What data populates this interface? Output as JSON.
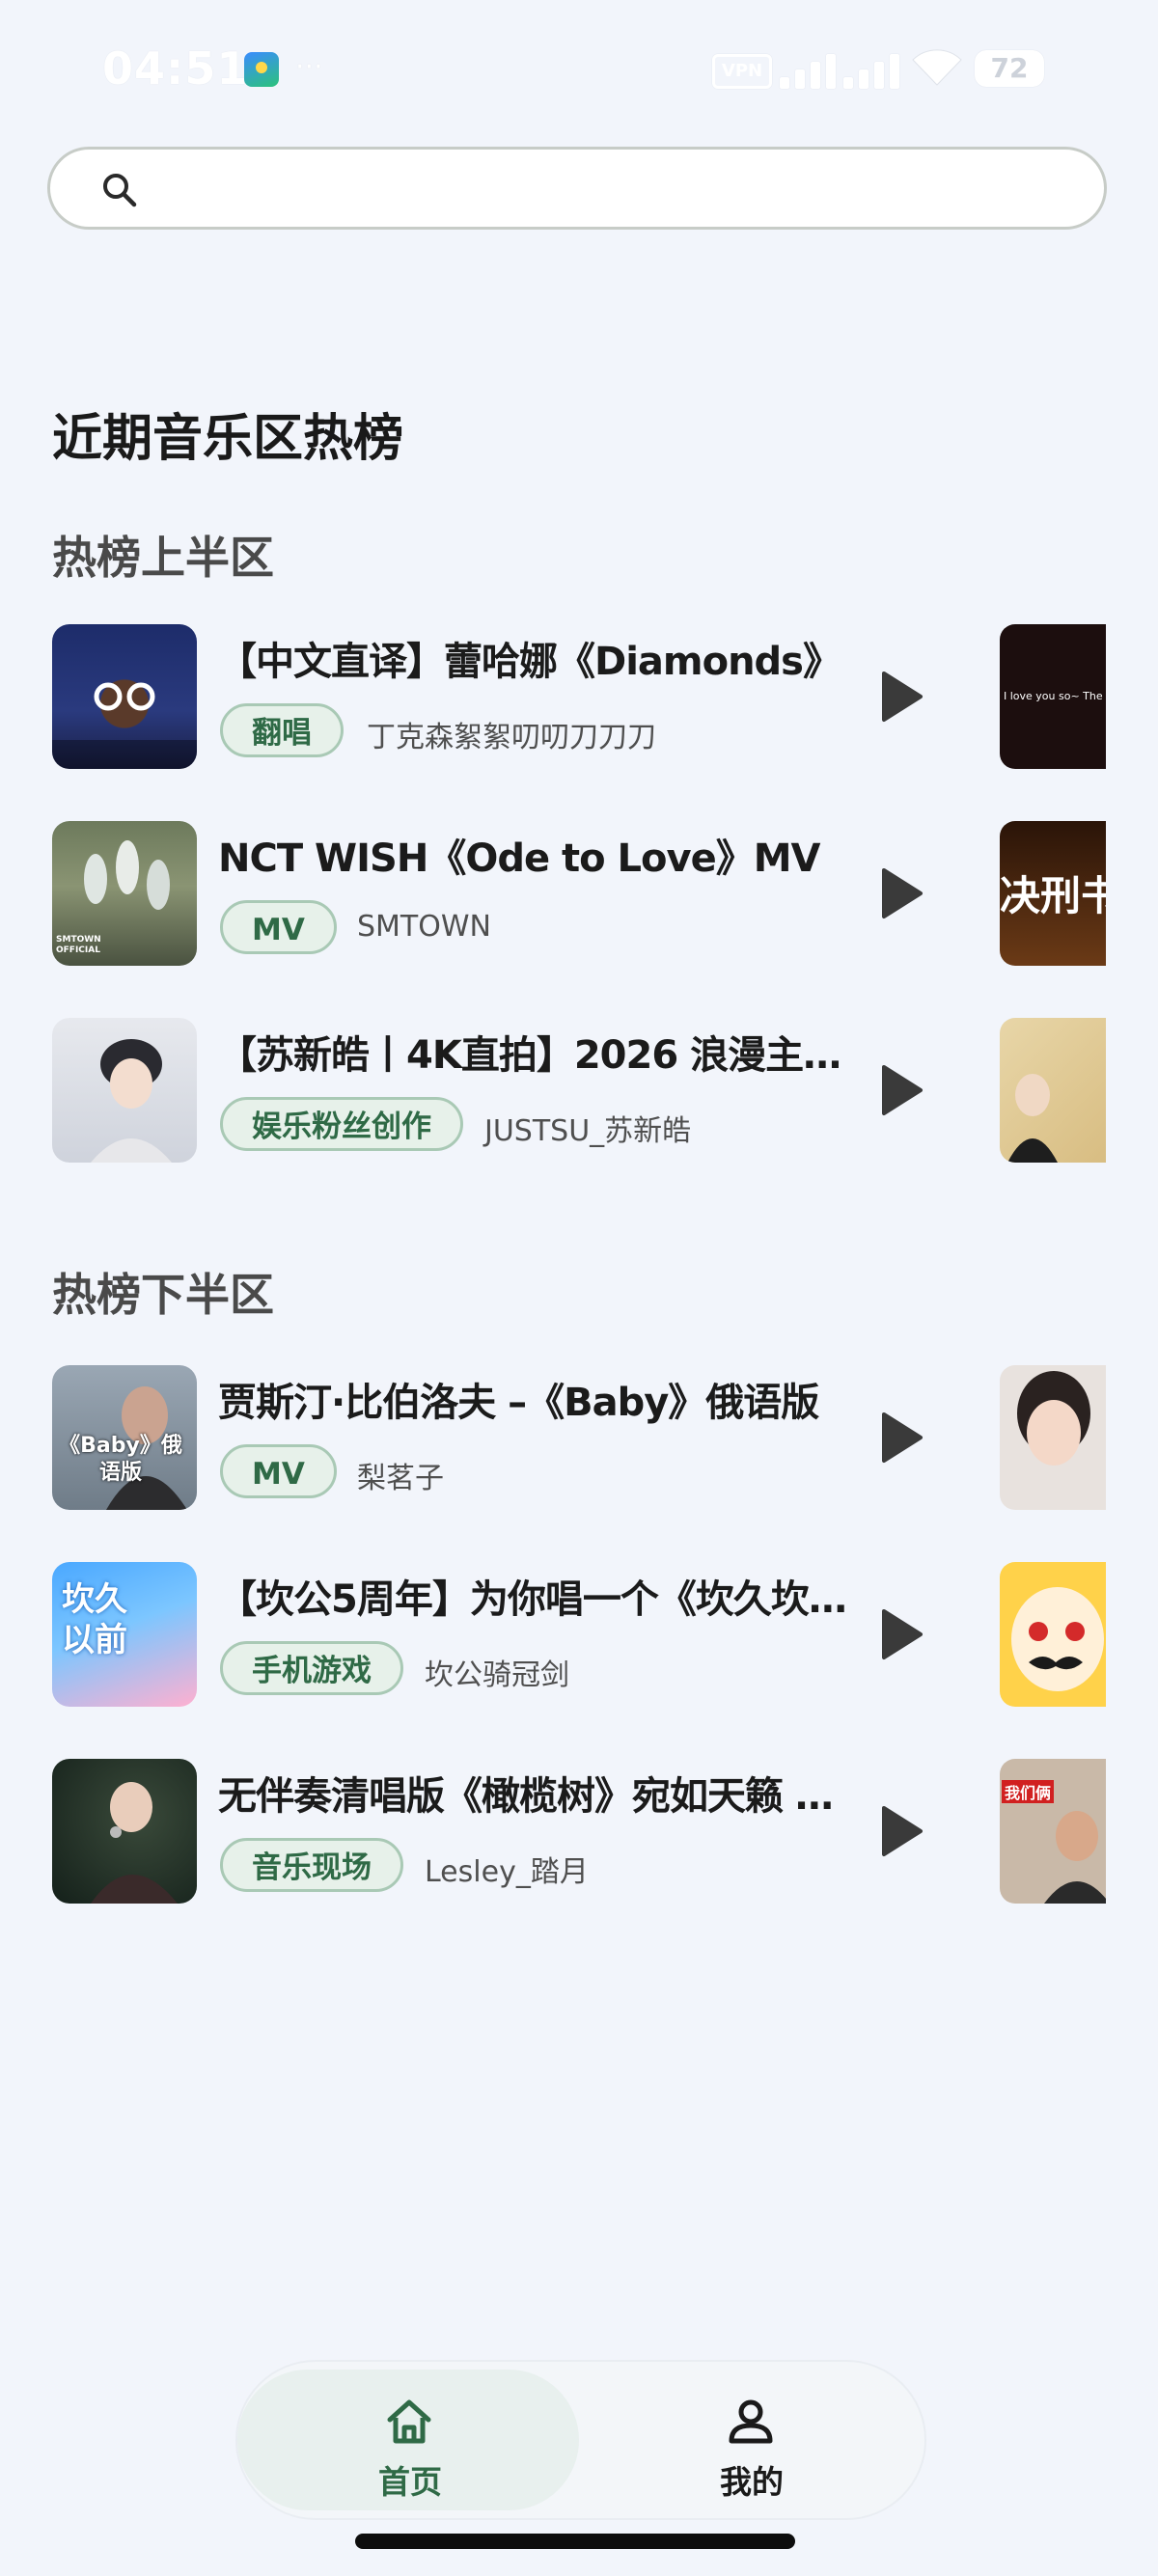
{
  "status_bar": {
    "time": "04:51",
    "more": "···",
    "vpn": "VPN",
    "battery": "72"
  },
  "search": {
    "placeholder": "",
    "value": ""
  },
  "page_title": "近期音乐区热榜",
  "sections": [
    {
      "title": "热榜上半区",
      "items": [
        {
          "title": "【中文直译】蕾哈娜《Diamonds》",
          "tag": "翻唱",
          "uploader": "丁克森絮絮叨叨刀刀刀",
          "thumb_text": "",
          "side_text": "I love you so~ The"
        },
        {
          "title": "NCT WISH《Ode to Love》MV",
          "tag": "MV",
          "uploader": "SMTOWN",
          "thumb_text": "SMTOWN OFFICIAL",
          "side_text": "决刑书"
        },
        {
          "title": "【苏新皓丨4K直拍】2026 浪漫主…",
          "tag": "娱乐粉丝创作",
          "uploader": "JUSTSU_苏新皓",
          "thumb_text": "",
          "side_text": ""
        }
      ]
    },
    {
      "title": "热榜下半区",
      "items": [
        {
          "title": "贾斯汀·比伯洛夫 –《Baby》俄语版",
          "tag": "MV",
          "uploader": "梨茗子",
          "thumb_text": "《Baby》俄语版",
          "side_text": ""
        },
        {
          "title": "【坎公5周年】为你唱一个《坎久坎…",
          "tag": "手机游戏",
          "uploader": "坎公骑冠剑",
          "thumb_text": "坎久以前",
          "side_text": ""
        },
        {
          "title": "无伴奏清唱版《橄榄树》宛如天籁 …",
          "tag": "音乐现场",
          "uploader": "Lesley_踏月",
          "thumb_text": "",
          "side_text": "我们俩"
        }
      ]
    }
  ],
  "bottom_nav": {
    "home": "首页",
    "mine": "我的"
  },
  "colors": {
    "background": "#f2f5fb",
    "accent": "#2f6a46",
    "chip_bg": "#e7f1ea",
    "chip_border": "#a9c9b5",
    "play": "#3a3a3a"
  },
  "icons": {
    "search": "search-icon",
    "play": "play-icon",
    "home": "home-icon",
    "profile": "person-icon"
  }
}
